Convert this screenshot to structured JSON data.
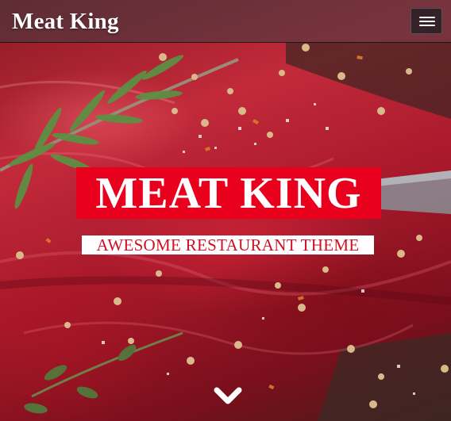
{
  "navbar": {
    "brand": "Meat King",
    "menu_icon": "hamburger-menu-icon"
  },
  "hero": {
    "title": "MEAT KING",
    "subtitle": "AWESOME RESTAURANT THEME",
    "scroll_icon": "chevron-down-icon",
    "background_image": "raw-steak-with-rosemary-and-spices",
    "colors": {
      "title_bg": "#e8001d",
      "title_text": "#ffffff",
      "subtitle_bg": "#ffffff",
      "subtitle_text": "#d10f22"
    }
  }
}
